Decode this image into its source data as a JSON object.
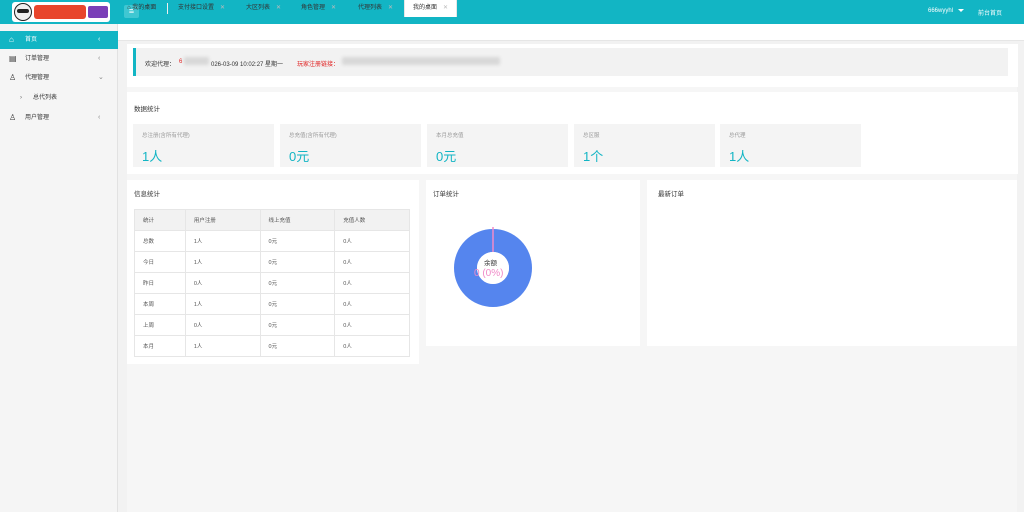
{
  "header": {
    "logo_text": "",
    "logo_sub": "",
    "menu_icon": "hamburger-icon",
    "username": "666wyyhl",
    "front_link": "前台首页"
  },
  "sidebar": {
    "items": [
      {
        "label": "首页",
        "icon": "home-icon"
      },
      {
        "label": "订单管理",
        "icon": "order-icon"
      },
      {
        "label": "代理管理",
        "icon": "agent-icon"
      },
      {
        "label": "总代列表",
        "icon": "chevron-right-icon"
      },
      {
        "label": "用户管理",
        "icon": "user-icon"
      }
    ]
  },
  "tabs": [
    {
      "label": "我的桌面"
    },
    {
      "label": "支付接口设置"
    },
    {
      "label": "大区列表"
    },
    {
      "label": "角色管理"
    },
    {
      "label": "代理列表"
    },
    {
      "label": "我的桌面"
    }
  ],
  "welcome": {
    "prefix": "欢迎代理：",
    "name": "6",
    "datetime": "026-03-09  10:02:27  星期一",
    "link_label": "玩家注册链接："
  },
  "data_stats": {
    "title": "数据统计",
    "cards": [
      {
        "label": "总注册(含所有代理)",
        "value": "1人"
      },
      {
        "label": "总充值(含所有代理)",
        "value": "0元"
      },
      {
        "label": "本月总充值",
        "value": "0元"
      },
      {
        "label": "总区服",
        "value": "1个"
      },
      {
        "label": "总代理",
        "value": "1人"
      }
    ]
  },
  "info_stats": {
    "title": "信息统计",
    "headers": [
      "统计",
      "用户注册",
      "线上充值",
      "充值人数"
    ],
    "rows": [
      [
        "总数",
        "1人",
        "0元",
        "0人"
      ],
      [
        "今日",
        "1人",
        "0元",
        "0人"
      ],
      [
        "昨日",
        "0人",
        "0元",
        "0人"
      ],
      [
        "本周",
        "1人",
        "0元",
        "0人"
      ],
      [
        "上周",
        "0人",
        "0元",
        "0人"
      ],
      [
        "本月",
        "1人",
        "0元",
        "0人"
      ]
    ]
  },
  "order_stats": {
    "title": "订单统计"
  },
  "latest_orders": {
    "title": "最新订单"
  },
  "chart_data": {
    "type": "pie",
    "title": "",
    "slices": [
      {
        "label": "余额",
        "value": 0,
        "percent": 0,
        "color": "#f08ac8"
      }
    ],
    "center_label": "余额",
    "center_value": "0 (0%)",
    "ring_color": "#5585ee"
  }
}
